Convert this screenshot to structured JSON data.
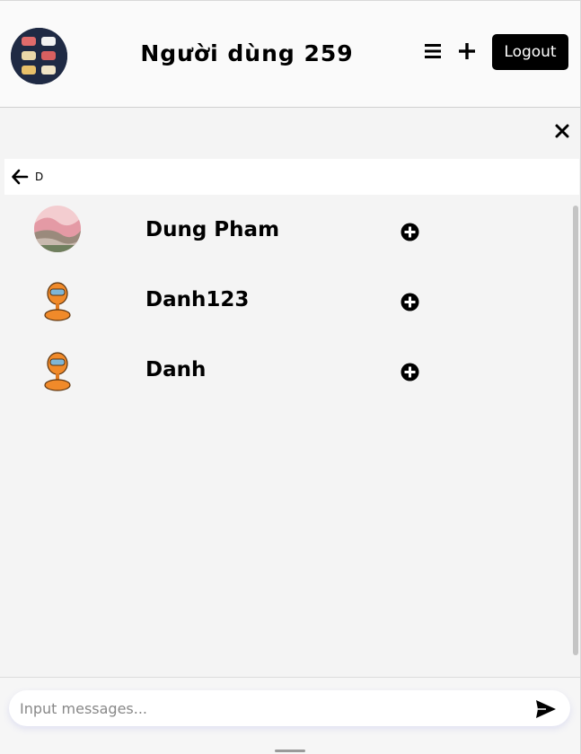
{
  "header": {
    "title": "Người dùng 259",
    "logout_label": "Logout",
    "icons": {
      "menu": "hamburger-menu-icon",
      "add": "plus-icon"
    }
  },
  "search": {
    "value": "D",
    "icons": {
      "close": "close-icon",
      "back": "arrow-left-icon"
    }
  },
  "results": [
    {
      "name": "Dung Pham",
      "avatar": "landscape-photo",
      "action_icon": "plus-circle-icon"
    },
    {
      "name": "Danh123",
      "avatar": "orange-robot",
      "action_icon": "plus-circle-icon"
    },
    {
      "name": "Danh",
      "avatar": "orange-robot",
      "action_icon": "plus-circle-icon"
    }
  ],
  "composer": {
    "placeholder": "Input messages...",
    "send_icon": "send-icon"
  },
  "colors": {
    "header_bg": "#fafafa",
    "body_bg": "#f4f4f4",
    "logout_bg": "#000000",
    "logout_text": "#ffffff"
  }
}
